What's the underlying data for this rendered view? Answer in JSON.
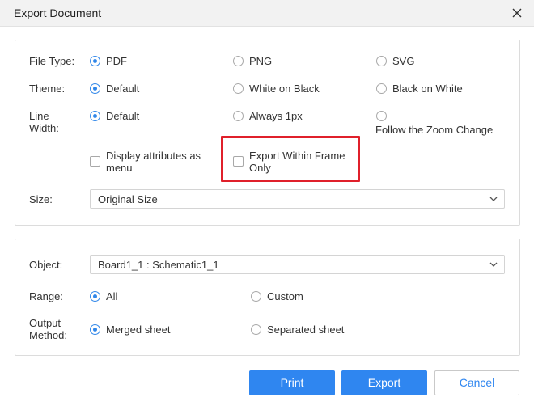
{
  "dialog": {
    "title": "Export Document"
  },
  "format_panel": {
    "file_type": {
      "label": "File Type:",
      "options": [
        "PDF",
        "PNG",
        "SVG"
      ],
      "selected": "PDF"
    },
    "theme": {
      "label": "Theme:",
      "options": [
        "Default",
        "White on Black",
        "Black on White"
      ],
      "selected": "Default"
    },
    "line_width": {
      "label_line1": "Line",
      "label_line2": "Width:",
      "options": [
        "Default",
        "Always 1px",
        "Follow the Zoom Change"
      ],
      "selected": "Default"
    },
    "display_attributes": {
      "line1": "Display attributes as",
      "line2": "menu",
      "checked": false
    },
    "export_within_frame": {
      "line1": "Export Within Frame",
      "line2": "Only",
      "checked": false
    },
    "size": {
      "label": "Size:",
      "value": "Original Size"
    }
  },
  "object_panel": {
    "object": {
      "label": "Object:",
      "value": "Board1_1 : Schematic1_1"
    },
    "range": {
      "label": "Range:",
      "options": [
        "All",
        "Custom"
      ],
      "selected": "All"
    },
    "output_method": {
      "label_line1": "Output",
      "label_line2": "Method:",
      "options": [
        "Merged sheet",
        "Separated sheet"
      ],
      "selected": "Merged sheet"
    }
  },
  "buttons": {
    "print": "Print",
    "export": "Export",
    "cancel": "Cancel"
  },
  "colors": {
    "accent": "#2f86f0",
    "highlight": "#e0202b"
  },
  "icons": {
    "close": "close-icon",
    "dropdown": "chevron-down-icon"
  }
}
